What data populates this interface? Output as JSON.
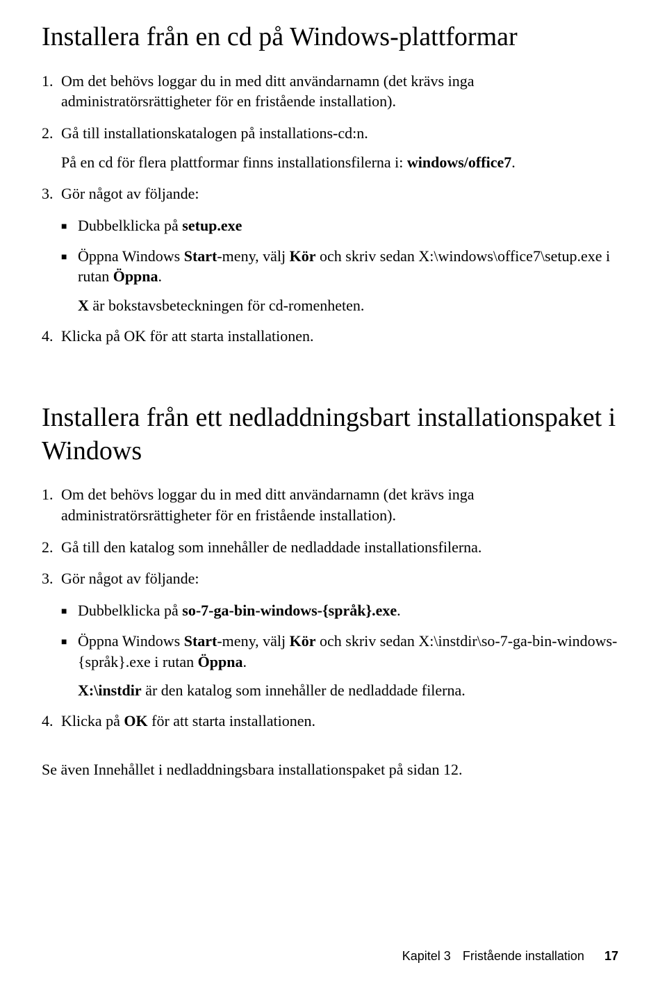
{
  "section1": {
    "heading": "Installera från en cd på Windows-plattformar",
    "items": [
      {
        "num": "1.",
        "text": "Om det behövs loggar du in med ditt användarnamn (det krävs inga administratörsrättigheter för en fristående installation)."
      },
      {
        "num": "2.",
        "text_before": "Gå till installationskatalogen på installations-cd:n.",
        "text_para2_before": "På en cd för flera plattformar finns installationsfilerna i: ",
        "text_para2_bold": "windows/office7",
        "text_para2_after": "."
      },
      {
        "num": "3.",
        "text": "Gör något av följande:"
      }
    ],
    "bullets": [
      {
        "pre": "Dubbelklicka på ",
        "bold": "setup.exe",
        "post": ""
      },
      {
        "pre": "Öppna Windows ",
        "b1": "Start",
        "mid1": "-meny, välj ",
        "b2": "Kör",
        "mid2": " och skriv sedan X:\\windows\\office7\\setup.exe i rutan ",
        "b3": "Öppna",
        "post": ".",
        "note_bold": "X",
        "note_rest": " är bokstavsbeteckningen för cd-romenheten."
      }
    ],
    "item4": {
      "num": "4.",
      "text": "Klicka på OK för att starta installationen."
    }
  },
  "section2": {
    "heading": "Installera från ett nedladdningsbart installationspaket i Windows",
    "items": [
      {
        "num": "1.",
        "text": "Om det behövs loggar du in med ditt användarnamn (det krävs inga administratörsrättigheter för en fristående installation)."
      },
      {
        "num": "2.",
        "text": "Gå till den katalog som innehåller de nedladdade installationsfilerna."
      },
      {
        "num": "3.",
        "text": "Gör något av följande:"
      }
    ],
    "bullets": [
      {
        "pre": "Dubbelklicka på ",
        "bold": "so-7-ga-bin-windows-{språk}.exe",
        "post": "."
      },
      {
        "pre": "Öppna Windows ",
        "b1": "Start",
        "mid1": "-meny, välj ",
        "b2": "Kör",
        "mid2": " och skriv sedan X:\\instdir\\so-7-ga-bin-windows-{språk}.exe i rutan ",
        "b3": "Öppna",
        "post": ".",
        "note_bold": "X:\\instdir",
        "note_rest": " är den katalog som innehåller de nedladdade filerna."
      }
    ],
    "item4": {
      "num": "4.",
      "pre": "Klicka på ",
      "bold": "OK",
      "post": " för att starta installationen."
    },
    "closing": "Se även Innehållet i nedladdningsbara installationspaket på sidan 12."
  },
  "footer": {
    "chapter": "Kapitel  3",
    "title": "Fristående installation",
    "page": "17"
  }
}
